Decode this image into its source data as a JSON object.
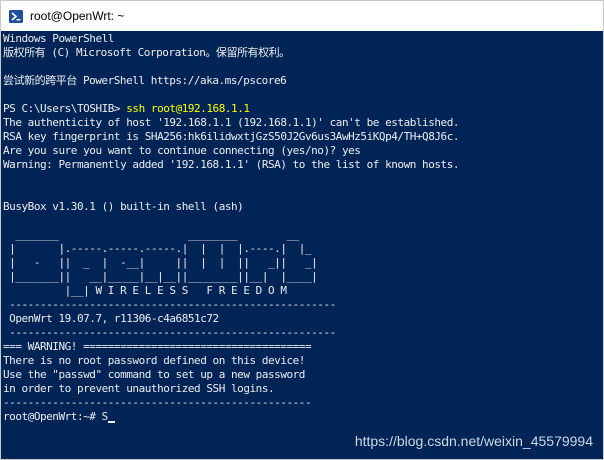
{
  "window": {
    "title": "root@OpenWrt: ~",
    "icon": "powershell-prompt-icon"
  },
  "terminal": {
    "background": "#012456",
    "text_color": "#eeedf0",
    "command_color": "#ffff00",
    "lines": [
      "Windows PowerShell",
      "版权所有 (C) Microsoft Corporation。保留所有权利。",
      "",
      "尝试新的跨平台 PowerShell https://aka.ms/pscore6",
      "",
      "PS C:\\Users\\TOSHIB> ",
      "The authenticity of host '192.168.1.1 (192.168.1.1)' can't be established.",
      "RSA key fingerprint is SHA256:hk6ilidwxtjGzS50J2Gv6us3AwHz5iKQp4/TH+Q8J6c.",
      "Are you sure you want to continue connecting (yes/no)? yes",
      "Warning: Permanently added '192.168.1.1' (RSA) to the list of known hosts.",
      "",
      "",
      "BusyBox v1.30.1 () built-in shell (ash)",
      "",
      "  _______                     ________        __",
      " |       |.-----.-----.-----.|  |  |  |.----.|  |_",
      " |   -   ||  _  |  -__|     ||  |  |  ||   _||   _|",
      " |_______||   __|_____|__|__||________||__|  |____|",
      "          |__| W I R E L E S S   F R E E D O M",
      " -----------------------------------------------------",
      " OpenWrt 19.07.7, r11306-c4a6851c72",
      " -----------------------------------------------------",
      "=== WARNING! =====================================",
      "There is no root password defined on this device!",
      "Use the \"passwd\" command to set up a new password",
      "in order to prevent unauthorized SSH logins.",
      "--------------------------------------------------",
      "root@OpenWrt:~# S"
    ],
    "command": "ssh root@192.168.1.1"
  },
  "watermark": "https://blog.csdn.net/weixin_45579994"
}
